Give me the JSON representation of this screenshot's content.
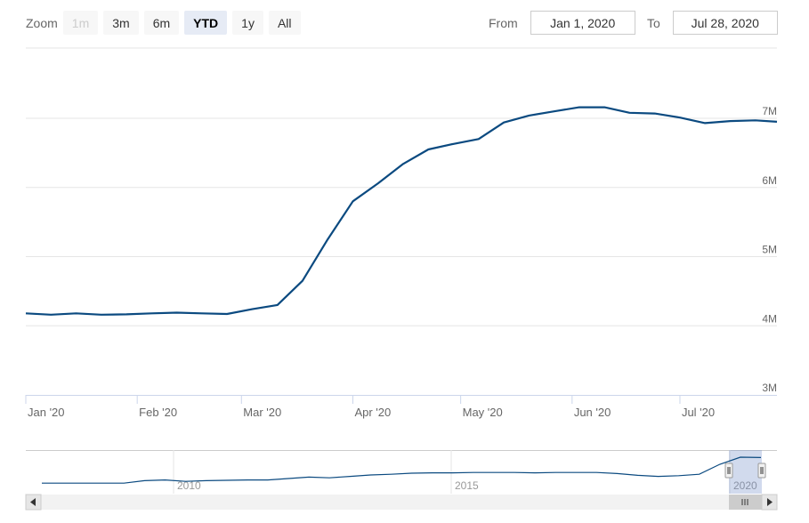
{
  "range_selector": {
    "zoom_label": "Zoom",
    "buttons": [
      {
        "label": "1m",
        "state": "disabled"
      },
      {
        "label": "3m",
        "state": "normal"
      },
      {
        "label": "6m",
        "state": "normal"
      },
      {
        "label": "YTD",
        "state": "selected"
      },
      {
        "label": "1y",
        "state": "normal"
      },
      {
        "label": "All",
        "state": "normal"
      }
    ],
    "from_label": "From",
    "from_value": "Jan 1, 2020",
    "to_label": "To",
    "to_value": "Jul 28, 2020"
  },
  "chart_data": {
    "type": "line",
    "title": "",
    "xlabel": "",
    "ylabel": "",
    "grid": true,
    "legend": "none",
    "line_color": "#0b4a80",
    "x_ticks": [
      "Jan '20",
      "Feb '20",
      "Mar '20",
      "Apr '20",
      "May '20",
      "Jun '20",
      "Jul '20"
    ],
    "y_ticks": [
      "3M",
      "4M",
      "5M",
      "6M",
      "7M"
    ],
    "ylim": [
      3000000,
      7000000
    ],
    "xlim": [
      "2020-01-01",
      "2020-07-28"
    ],
    "series": [
      {
        "x": [
          "2020-01-01",
          "2020-01-08",
          "2020-01-15",
          "2020-01-22",
          "2020-01-29",
          "2020-02-05",
          "2020-02-12",
          "2020-02-19",
          "2020-02-26",
          "2020-03-04",
          "2020-03-11",
          "2020-03-18",
          "2020-03-25",
          "2020-04-01",
          "2020-04-08",
          "2020-04-15",
          "2020-04-22",
          "2020-04-29",
          "2020-05-06",
          "2020-05-13",
          "2020-05-20",
          "2020-05-27",
          "2020-06-03",
          "2020-06-10",
          "2020-06-17",
          "2020-06-24",
          "2020-07-01",
          "2020-07-08",
          "2020-07-15",
          "2020-07-22",
          "2020-07-28"
        ],
        "values": [
          4180000,
          4160000,
          4180000,
          4160000,
          4165000,
          4180000,
          4190000,
          4180000,
          4170000,
          4240000,
          4300000,
          4650000,
          5250000,
          5800000,
          6060000,
          6340000,
          6550000,
          6630000,
          6700000,
          6940000,
          7040000,
          7100000,
          7160000,
          7160000,
          7080000,
          7070000,
          7010000,
          6930000,
          6960000,
          6970000,
          6950000
        ]
      }
    ],
    "navigator": {
      "labels": [
        "2010",
        "2015",
        "2020"
      ],
      "values": [
        4170000,
        4170000,
        4170000,
        4170000,
        4170000,
        4240000,
        4260000,
        4220000,
        4240000,
        4250000,
        4260000,
        4260000,
        4300000,
        4340000,
        4320000,
        4360000,
        4400000,
        4420000,
        4450000,
        4460000,
        4460000,
        4470000,
        4470000,
        4470000,
        4460000,
        4470000,
        4470000,
        4470000,
        4440000,
        4390000,
        4360000,
        4380000,
        4420000,
        4700000,
        4900000,
        4890000
      ]
    }
  }
}
